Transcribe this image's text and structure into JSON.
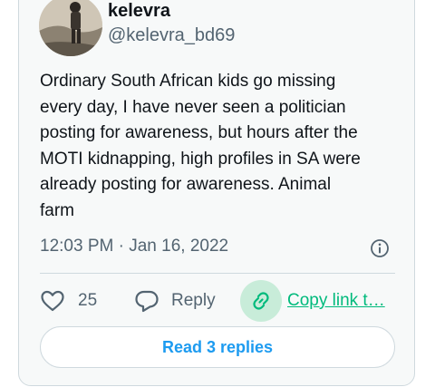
{
  "tweet": {
    "author_name": "kelevra",
    "author_handle": "@kelevra_bd69",
    "text": "Ordinary South African kids go missing\nevery day, I have never seen a politician\nposting for awareness, but hours after the\nMOTI kidnapping, high profiles in SA were\nalready posting for awareness. Animal\nfarm",
    "timestamp": "12:03 PM · Jan 16, 2022"
  },
  "actions": {
    "like_count": "25",
    "reply_label": "Reply",
    "copy_link_label": "Copy link t…"
  },
  "read_replies_label": "Read 3 replies",
  "colors": {
    "accent_blue": "#1d9bf0",
    "copy_green": "#00ba7c",
    "secondary_text": "#536471",
    "border": "#cfd9de"
  },
  "icons": [
    "info-icon",
    "heart-icon",
    "reply-icon",
    "link-icon"
  ]
}
